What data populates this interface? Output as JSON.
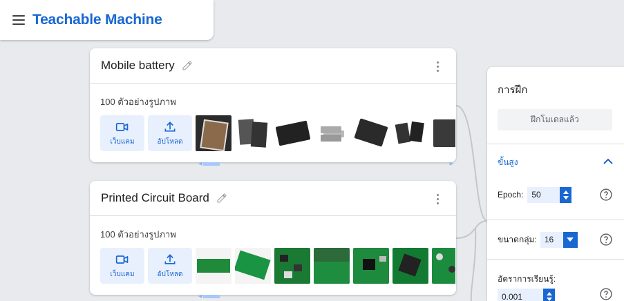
{
  "header": {
    "title": "Teachable Machine"
  },
  "classes": [
    {
      "name": "Mobile battery",
      "sample_count": "100 ตัวอย่างรูปภาพ",
      "webcam_label": "เว็บแคม",
      "upload_label": "อัปโหลด"
    },
    {
      "name": "Printed Circuit Board",
      "sample_count": "100 ตัวอย่างรูปภาพ",
      "webcam_label": "เว็บแคม",
      "upload_label": "อัปโหลด"
    }
  ],
  "training": {
    "title": "การฝึก",
    "train_button": "ฝึกโมเดลแล้ว",
    "advanced_label": "ขั้นสูง",
    "epoch_label": "Epoch:",
    "epoch_value": "50",
    "batch_label": "ขนาดกลุ่ม:",
    "batch_value": "16",
    "lr_label": "อัตราการเรียนรู้:",
    "lr_value": "0.001"
  },
  "colors": {
    "brand": "#1967d2",
    "button_bg": "#e8f0fe"
  }
}
